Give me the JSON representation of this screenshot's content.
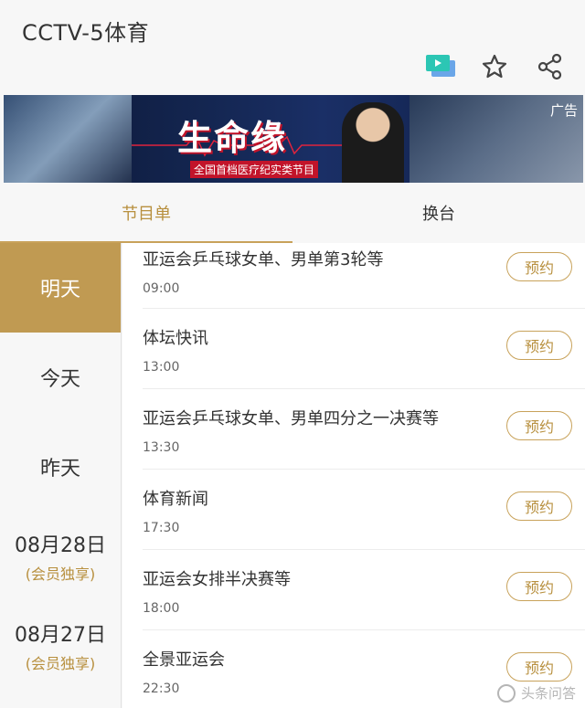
{
  "header": {
    "title": "CCTV-5体育"
  },
  "icons": {
    "tv": "tv-icon",
    "star": "star-icon",
    "share": "share-icon"
  },
  "banner": {
    "ad_tag": "广告",
    "logo_text": "生命缘",
    "subtitle": "全国首档医疗纪实类节目"
  },
  "tabs": [
    {
      "label": "节目单",
      "active": true
    },
    {
      "label": "换台",
      "active": false
    }
  ],
  "days": [
    {
      "label": "明天",
      "sub": "",
      "active": true
    },
    {
      "label": "今天",
      "sub": ""
    },
    {
      "label": "昨天",
      "sub": ""
    },
    {
      "label": "08月28日",
      "sub": "(会员独享)"
    },
    {
      "label": "08月27日",
      "sub": "(会员独享)"
    }
  ],
  "programs": [
    {
      "name": "亚运会乒乓球女单、男单第3轮等",
      "time": "09:00",
      "button": "预约"
    },
    {
      "name": "体坛快讯",
      "time": "13:00",
      "button": "预约"
    },
    {
      "name": "亚运会乒乓球女单、男单四分之一决赛等",
      "time": "13:30",
      "button": "预约"
    },
    {
      "name": "体育新闻",
      "time": "17:30",
      "button": "预约"
    },
    {
      "name": "亚运会女排半决赛等",
      "time": "18:00",
      "button": "预约"
    },
    {
      "name": "全景亚运会",
      "time": "22:30",
      "button": "预约"
    }
  ],
  "watermark": "头条问答",
  "colors": {
    "accent": "#c09a52",
    "accent_text": "#b8903f",
    "tv_icon_teal": "#2cc6b4",
    "tv_icon_blue": "#6aa6e8"
  }
}
